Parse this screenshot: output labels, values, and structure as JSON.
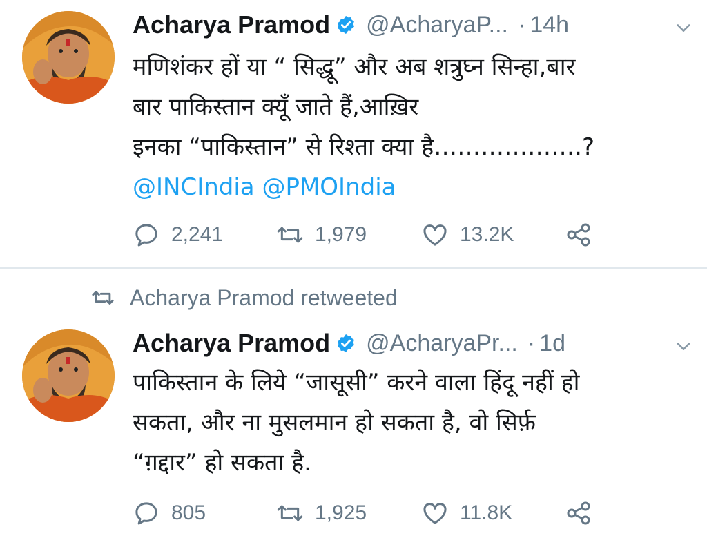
{
  "colors": {
    "text": "#14171a",
    "secondary": "#657786",
    "link": "#1da1f2",
    "verified": "#1da1f2",
    "divider": "#e1e8ed"
  },
  "tweets": [
    {
      "author_name": "Acharya Pramod",
      "handle": "@AcharyaP...",
      "separator": "·",
      "time": "14h",
      "text_lines": [
        "मणिशंकर हों या “ सिद्धू” और अब शत्रुघ्न सिन्हा,बार",
        "बार पाकिस्तान क्यूँ जाते हैं,आख़िर",
        "इनका “पाकिस्तान” से रिश्ता क्या है……………….?"
      ],
      "mentions": "@INCIndia @PMOIndia",
      "replies": "2,241",
      "retweets": "1,979",
      "likes": "13.2K"
    },
    {
      "retweeted_by": "Acharya Pramod retweeted",
      "author_name": "Acharya Pramod",
      "handle": "@AcharyaPr...",
      "separator": "·",
      "time": "1d",
      "text_lines": [
        "पाकिस्तान के लिये “जासूसी” करने वाला हिंदू नहीं हो",
        "सकता, और ना मुसलमान हो सकता है, वो सिर्फ़",
        "“ग़द्दार” हो सकता है."
      ],
      "replies": "805",
      "retweets": "1,925",
      "likes": "11.8K"
    }
  ],
  "icons": {
    "verified": "verified-badge-icon",
    "caret": "chevron-down-icon",
    "reply": "reply-icon",
    "retweet": "retweet-icon",
    "like": "heart-icon",
    "share": "share-icon"
  }
}
